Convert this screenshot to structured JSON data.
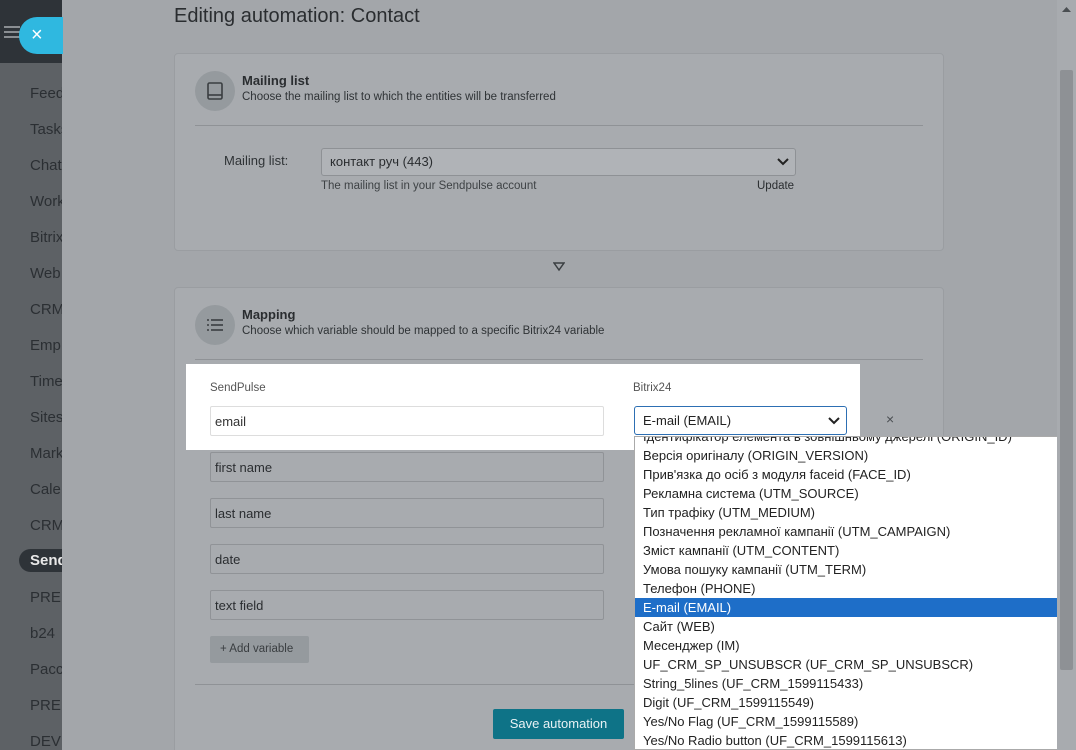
{
  "page": {
    "title": "Editing automation: Contact"
  },
  "sidebar": {
    "items": [
      {
        "label": "Feed"
      },
      {
        "label": "Tasks"
      },
      {
        "label": "Chat"
      },
      {
        "label": "Work"
      },
      {
        "label": "Bitrix"
      },
      {
        "label": "Web"
      },
      {
        "label": "CRM"
      },
      {
        "label": "Emp"
      },
      {
        "label": "Time"
      },
      {
        "label": "Sites"
      },
      {
        "label": "Mark"
      },
      {
        "label": "Cale"
      },
      {
        "label": "CRM"
      },
      {
        "label": "Send"
      },
      {
        "label": "PRE"
      },
      {
        "label": "b24"
      },
      {
        "label": "Pacc"
      },
      {
        "label": "PRE"
      },
      {
        "label": "DEV"
      }
    ],
    "close_icon": "×"
  },
  "mailing": {
    "title": "Mailing list",
    "desc": "Choose the mailing list to which the entities will be transferred",
    "label": "Mailing list:",
    "selected": "контакт руч (443)",
    "hint": "The mailing list in your Sendpulse account",
    "update": "Update"
  },
  "mapping": {
    "title": "Mapping",
    "desc": "Choose which variable should be mapped to a specific Bitrix24 variable",
    "col_sendpulse": "SendPulse",
    "col_bitrix": "Bitrix24",
    "rows": [
      {
        "value": "email"
      },
      {
        "value": "first name"
      },
      {
        "value": "last name"
      },
      {
        "value": "date"
      },
      {
        "value": "text field"
      }
    ],
    "bitrix_selected": "E-mail (EMAIL)",
    "remove": "×",
    "add_variable": "Add variable",
    "add_icon": "+",
    "save": "Save automation"
  },
  "dropdown": {
    "options": [
      "Ідентифікатор елемента в зовнішньому джерелі (ORIGIN_ID)",
      "Версія оригіналу (ORIGIN_VERSION)",
      "Прив'язка до осіб з модуля faceid (FACE_ID)",
      "Рекламна система (UTM_SOURCE)",
      "Тип трафіку (UTM_MEDIUM)",
      "Позначення рекламної кампанії (UTM_CAMPAIGN)",
      "Зміст кампанії (UTM_CONTENT)",
      "Умова пошуку кампанії (UTM_TERM)",
      "Телефон (PHONE)",
      "E-mail (EMAIL)",
      "Сайт (WEB)",
      "Месенджер (IM)",
      "UF_CRM_SP_UNSUBSCR (UF_CRM_SP_UNSUBSCR)",
      "String_5lines (UF_CRM_1599115433)",
      "Digit (UF_CRM_1599115549)",
      "Yes/No Flag (UF_CRM_1599115589)",
      "Yes/No Radio button (UF_CRM_1599115613)"
    ],
    "selected_index": 9
  },
  "colors": {
    "accent": "#0e7387",
    "highlight_select": "#1e6ec8",
    "close": "#2fb8e0"
  }
}
